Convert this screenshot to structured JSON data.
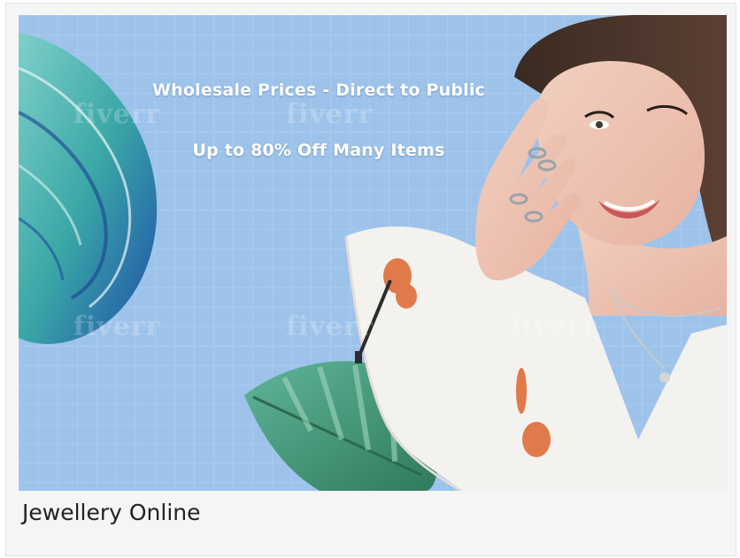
{
  "banner": {
    "headline": "Wholesale Prices - Direct to Public",
    "subline": "Up to 80% Off Many Items",
    "watermark": "fiverr",
    "colors": {
      "sky": "#9ec3ea",
      "grid": "#b6d3f1",
      "leaf_teal": "#4fb3ad",
      "leaf_green": "#3f8f6a",
      "dress": "#f4f2ee"
    }
  },
  "caption": {
    "title": "Jewellery Online"
  }
}
